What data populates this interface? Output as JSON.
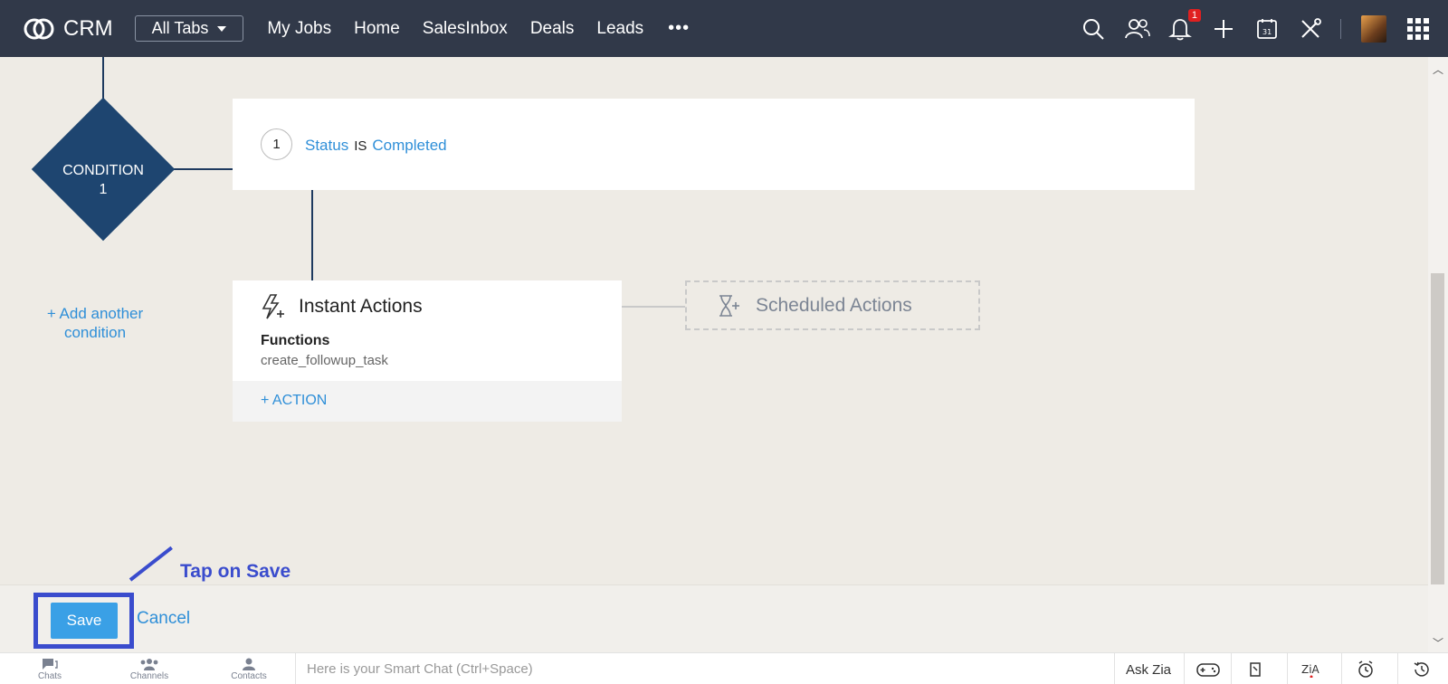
{
  "app": {
    "name": "CRM"
  },
  "nav": {
    "all_tabs": "All Tabs",
    "links": [
      "My Jobs",
      "Home",
      "SalesInbox",
      "Deals",
      "Leads"
    ],
    "more": "•••",
    "notification_count": "1",
    "icons": [
      "search-icon",
      "contacts-icon",
      "bell-icon",
      "plus-icon",
      "calendar-icon",
      "tools-icon",
      "avatar",
      "apps-grid-icon"
    ]
  },
  "flow": {
    "condition_label": "CONDITION",
    "condition_number": "1",
    "criteria_index": "1",
    "criteria_field": "Status",
    "criteria_operator": "IS",
    "criteria_value": "Completed",
    "add_condition": "+ Add another condition",
    "instant_title": "Instant Actions",
    "function_label": "Functions",
    "function_name": "create_followup_task",
    "add_action": "+ ACTION",
    "scheduled_title": "Scheduled Actions"
  },
  "footer": {
    "save": "Save",
    "cancel": "Cancel",
    "annotation": "Tap on Save"
  },
  "chatbar": {
    "chats": "Chats",
    "channels": "Channels",
    "contacts": "Contacts",
    "placeholder": "Here is your Smart Chat (Ctrl+Space)",
    "ask_zia": "Ask Zia"
  },
  "colors": {
    "topbar": "#313949",
    "accent": "#2f8fd8",
    "condition": "#1e4570",
    "annotation": "#3a4ccd"
  }
}
